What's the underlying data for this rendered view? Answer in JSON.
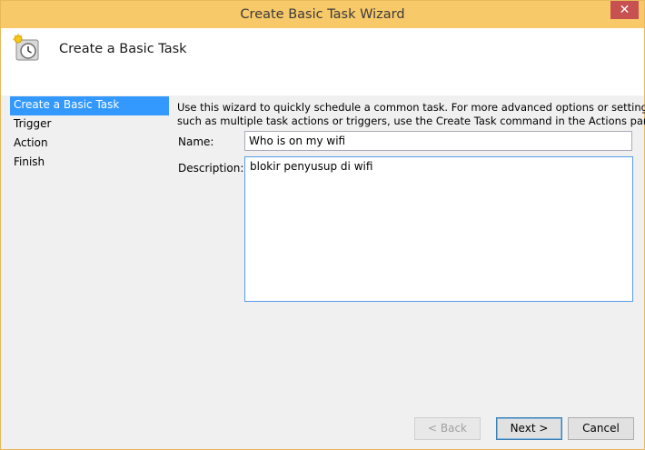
{
  "window": {
    "title": "Create Basic Task Wizard",
    "close_glyph": "✕",
    "accent_color": "#f8c968"
  },
  "header": {
    "icon": "task-scheduler-clock-icon",
    "title": "Create a Basic Task"
  },
  "nav": {
    "items": [
      {
        "label": "Create a Basic Task",
        "active": true
      },
      {
        "label": "Trigger",
        "active": false
      },
      {
        "label": "Action",
        "active": false
      },
      {
        "label": "Finish",
        "active": false
      }
    ]
  },
  "content": {
    "intro_line1": "Use this wizard to quickly schedule a common task.  For more advanced options or settings",
    "intro_line2": "such as multiple task actions or triggers, use the Create Task command in the Actions pane.",
    "name_label": "Name:",
    "name_value": "Who is on my wifi",
    "description_label": "Description:",
    "description_value": "blokir penyusup di wifi"
  },
  "buttons": {
    "back": "< Back",
    "next": "Next >",
    "cancel": "Cancel"
  }
}
